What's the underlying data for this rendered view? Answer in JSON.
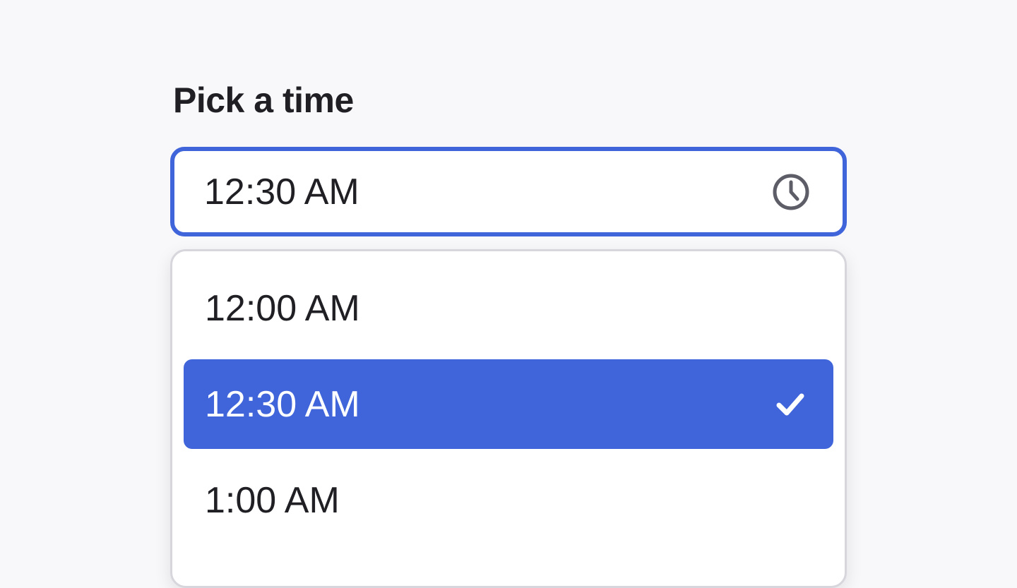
{
  "label": "Pick a time",
  "input": {
    "value": "12:30 AM",
    "icon": "clock-icon"
  },
  "options": [
    {
      "label": "12:00 AM",
      "selected": false
    },
    {
      "label": "12:30 AM",
      "selected": true
    },
    {
      "label": "1:00 AM",
      "selected": false
    }
  ],
  "colors": {
    "accent": "#4065db",
    "background": "#f8f8fa",
    "text": "#1f1f24",
    "icon": "#5d5d68"
  }
}
